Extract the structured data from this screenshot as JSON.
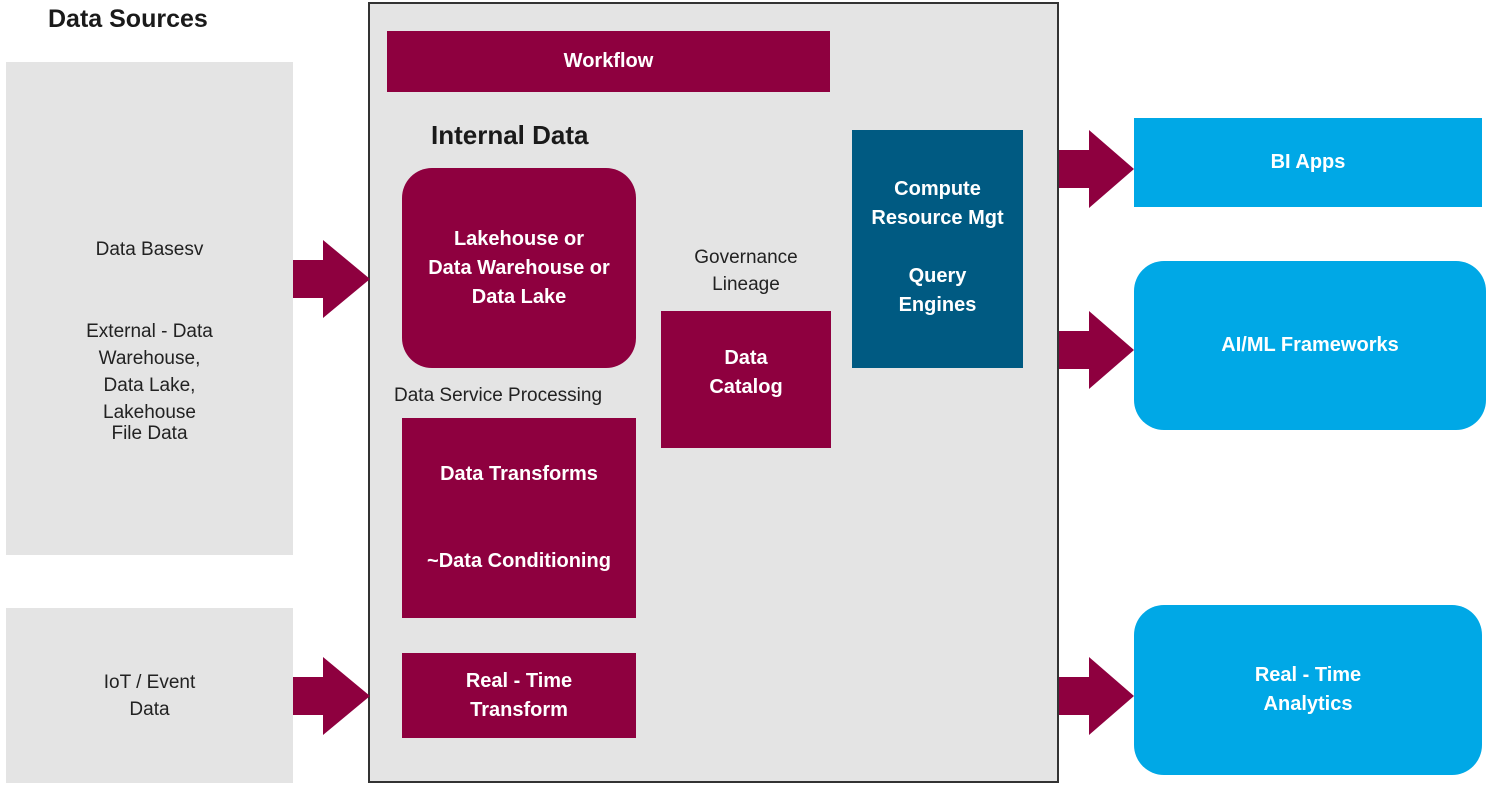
{
  "colors": {
    "maroon": "#8e003f",
    "navy": "#005a82",
    "blue": "#00a8e6",
    "panel_gray": "#e4e4e4"
  },
  "data_sources": {
    "title": "Data Sources",
    "batch_items": [
      "Data Basesv",
      "External - Data\nWarehouse,\nData Lake,\nLakehouse",
      "File Data"
    ],
    "stream_item": "IoT / Event\nData"
  },
  "platform": {
    "workflow": "Workflow",
    "internal_data_title": "Internal Data",
    "storage": "Lakehouse or\nData Warehouse or\nData Lake",
    "data_service_label": "Data Service Processing",
    "transforms": "Data Transforms",
    "conditioning": "~Data Conditioning",
    "realtime_transform": "Real - Time\nTransform",
    "governance_label": "Governance\nLineage",
    "catalog": "Data\nCatalog",
    "compute": "Compute\nResource Mgt",
    "query": "Query\nEngines"
  },
  "outputs": {
    "bi": "BI Apps",
    "aiml": "AI/ML Frameworks",
    "realtime": "Real - Time\nAnalytics"
  },
  "arrows": [
    {
      "from": "batch-sources",
      "to": "platform",
      "icon": "right-arrow-icon"
    },
    {
      "from": "iot-sources",
      "to": "platform",
      "icon": "right-arrow-icon"
    },
    {
      "from": "platform",
      "to": "bi-apps",
      "icon": "right-arrow-icon"
    },
    {
      "from": "platform",
      "to": "aiml-frameworks",
      "icon": "right-arrow-icon"
    },
    {
      "from": "platform",
      "to": "realtime-analytics",
      "icon": "right-arrow-icon"
    }
  ]
}
